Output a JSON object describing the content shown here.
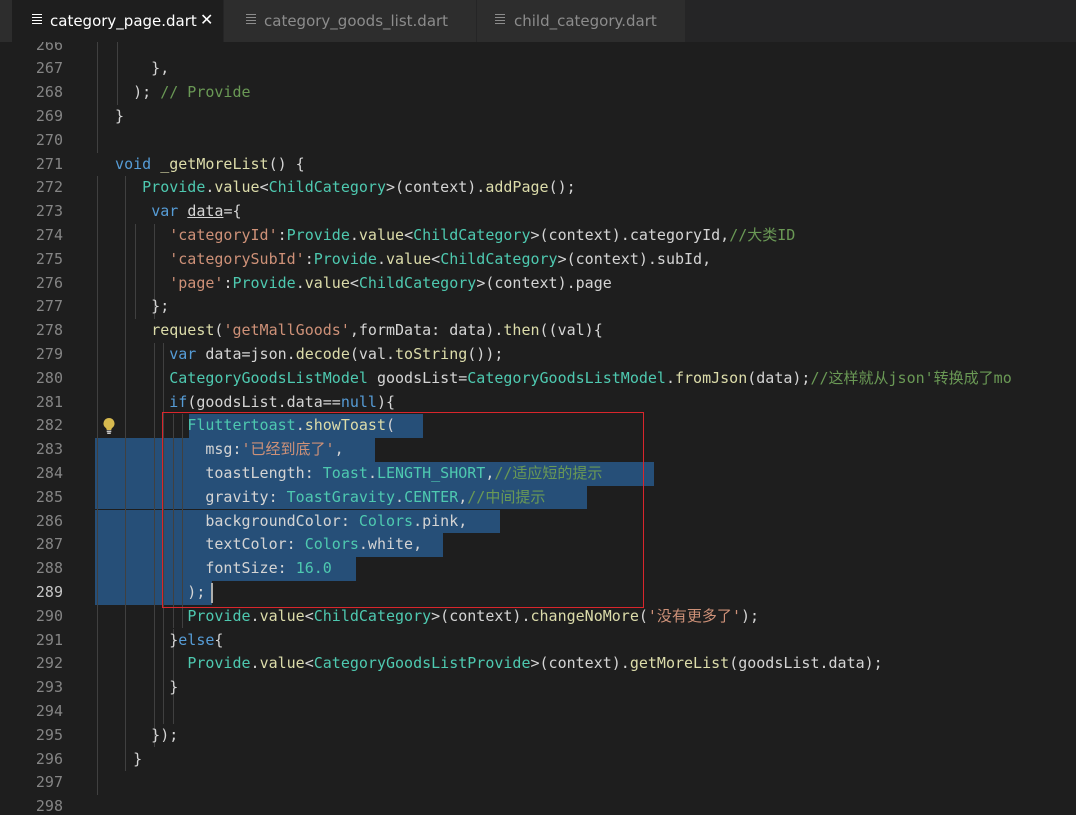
{
  "tabs": [
    {
      "label": "category_page.dart",
      "active": true,
      "close": "✕"
    },
    {
      "label": "category_goods_list.dart",
      "active": false
    },
    {
      "label": "child_category.dart",
      "active": false
    }
  ],
  "colors": {
    "keyword": "#569cd6",
    "type": "#4ec9b0",
    "function": "#dcdcaa",
    "string": "#ce9178",
    "comment": "#6a9955",
    "selection": "#264f78",
    "box": "#d9262c"
  },
  "current_line": 289,
  "lines": [
    {
      "n": 266,
      "t": [
        [
          "id",
          ""
        ]
      ]
    },
    {
      "n": 267,
      "t": [
        [
          "pr",
          "      },"
        ]
      ]
    },
    {
      "n": 268,
      "t": [
        [
          "pr",
          "    ); "
        ],
        [
          "cm",
          "// Provide"
        ]
      ]
    },
    {
      "n": 269,
      "t": [
        [
          "pr",
          "  }"
        ]
      ]
    },
    {
      "n": 270,
      "t": [
        [
          "pr",
          ""
        ]
      ]
    },
    {
      "n": 271,
      "t": [
        [
          "kw",
          "  void"
        ],
        [
          "pr",
          " "
        ],
        [
          "fn",
          "_getMoreList"
        ],
        [
          "pr",
          "() {"
        ]
      ]
    },
    {
      "n": 272,
      "t": [
        [
          "pr",
          "     "
        ],
        [
          "ty",
          "Provide"
        ],
        [
          "pr",
          "."
        ],
        [
          "fn",
          "value"
        ],
        [
          "pr",
          "<"
        ],
        [
          "ty",
          "ChildCategory"
        ],
        [
          "pr",
          ">(context)."
        ],
        [
          "fn",
          "addPage"
        ],
        [
          "pr",
          "();"
        ]
      ]
    },
    {
      "n": 273,
      "t": [
        [
          "pr",
          "      "
        ],
        [
          "kw",
          "var"
        ],
        [
          "pr",
          " "
        ],
        [
          "ul",
          "data"
        ],
        [
          "pr",
          "={"
        ]
      ]
    },
    {
      "n": 274,
      "t": [
        [
          "pr",
          "        "
        ],
        [
          "st",
          "'categoryId'"
        ],
        [
          "pr",
          ":"
        ],
        [
          "ty",
          "Provide"
        ],
        [
          "pr",
          "."
        ],
        [
          "fn",
          "value"
        ],
        [
          "pr",
          "<"
        ],
        [
          "ty",
          "ChildCategory"
        ],
        [
          "pr",
          ">(context).categoryId,"
        ],
        [
          "cm",
          "//大类ID"
        ]
      ]
    },
    {
      "n": 275,
      "t": [
        [
          "pr",
          "        "
        ],
        [
          "st",
          "'categorySubId'"
        ],
        [
          "pr",
          ":"
        ],
        [
          "ty",
          "Provide"
        ],
        [
          "pr",
          "."
        ],
        [
          "fn",
          "value"
        ],
        [
          "pr",
          "<"
        ],
        [
          "ty",
          "ChildCategory"
        ],
        [
          "pr",
          ">(context).subId,"
        ]
      ]
    },
    {
      "n": 276,
      "t": [
        [
          "pr",
          "        "
        ],
        [
          "st",
          "'page'"
        ],
        [
          "pr",
          ":"
        ],
        [
          "ty",
          "Provide"
        ],
        [
          "pr",
          "."
        ],
        [
          "fn",
          "value"
        ],
        [
          "pr",
          "<"
        ],
        [
          "ty",
          "ChildCategory"
        ],
        [
          "pr",
          ">(context).page"
        ]
      ]
    },
    {
      "n": 277,
      "t": [
        [
          "pr",
          "      };"
        ]
      ]
    },
    {
      "n": 278,
      "t": [
        [
          "pr",
          "      "
        ],
        [
          "fn",
          "request"
        ],
        [
          "pr",
          "("
        ],
        [
          "st",
          "'getMallGoods'"
        ],
        [
          "pr",
          ",formData: data)."
        ],
        [
          "fn",
          "then"
        ],
        [
          "pr",
          "((val){"
        ]
      ]
    },
    {
      "n": 279,
      "t": [
        [
          "pr",
          "        "
        ],
        [
          "kw",
          "var"
        ],
        [
          "pr",
          " data=json."
        ],
        [
          "fn",
          "decode"
        ],
        [
          "pr",
          "(val."
        ],
        [
          "fn",
          "toString"
        ],
        [
          "pr",
          "());"
        ]
      ]
    },
    {
      "n": 280,
      "t": [
        [
          "pr",
          "        "
        ],
        [
          "ty",
          "CategoryGoodsListModel"
        ],
        [
          "pr",
          " goodsList="
        ],
        [
          "ty",
          "CategoryGoodsListModel"
        ],
        [
          "pr",
          "."
        ],
        [
          "fn",
          "fromJson"
        ],
        [
          "pr",
          "(data);"
        ],
        [
          "cm",
          "//这样就从json'转换成了mo"
        ]
      ]
    },
    {
      "n": 281,
      "t": [
        [
          "pr",
          "        "
        ],
        [
          "kw",
          "if"
        ],
        [
          "pr",
          "(goodsList.data=="
        ],
        [
          "kw",
          "null"
        ],
        [
          "pr",
          "){"
        ]
      ]
    },
    {
      "n": 282,
      "t": [
        [
          "pr",
          "          "
        ],
        [
          "ty",
          "Fluttertoast"
        ],
        [
          "pr",
          "."
        ],
        [
          "fn",
          "showToast"
        ],
        [
          "pr",
          "("
        ]
      ]
    },
    {
      "n": 283,
      "t": [
        [
          "pr",
          "            msg:"
        ],
        [
          "st",
          "'已经到底了'"
        ],
        [
          "pr",
          ","
        ]
      ]
    },
    {
      "n": 284,
      "t": [
        [
          "pr",
          "            toastLength: "
        ],
        [
          "ty",
          "Toast"
        ],
        [
          "pr",
          "."
        ],
        [
          "ty",
          "LENGTH_SHORT"
        ],
        [
          "pr",
          ","
        ],
        [
          "cm",
          "//适应短的提示"
        ]
      ]
    },
    {
      "n": 285,
      "t": [
        [
          "pr",
          "            gravity: "
        ],
        [
          "ty",
          "ToastGravity"
        ],
        [
          "pr",
          "."
        ],
        [
          "ty",
          "CENTER"
        ],
        [
          "pr",
          ","
        ],
        [
          "cm",
          "//中间提示"
        ]
      ]
    },
    {
      "n": 286,
      "t": [
        [
          "pr",
          "            backgroundColor: "
        ],
        [
          "ty",
          "Colors"
        ],
        [
          "pr",
          ".pink,"
        ]
      ]
    },
    {
      "n": 287,
      "t": [
        [
          "pr",
          "            textColor: "
        ],
        [
          "ty",
          "Colors"
        ],
        [
          "pr",
          ".white,"
        ]
      ]
    },
    {
      "n": 288,
      "t": [
        [
          "pr",
          "            fontSize: "
        ],
        [
          "ty",
          "16.0"
        ]
      ]
    },
    {
      "n": 289,
      "t": [
        [
          "pr",
          "          );"
        ]
      ]
    },
    {
      "n": 290,
      "t": [
        [
          "pr",
          "          "
        ],
        [
          "ty",
          "Provide"
        ],
        [
          "pr",
          "."
        ],
        [
          "fn",
          "value"
        ],
        [
          "pr",
          "<"
        ],
        [
          "ty",
          "ChildCategory"
        ],
        [
          "pr",
          ">(context)."
        ],
        [
          "fn",
          "changeNoMore"
        ],
        [
          "pr",
          "("
        ],
        [
          "st",
          "'没有更多了'"
        ],
        [
          "pr",
          ");"
        ]
      ]
    },
    {
      "n": 291,
      "t": [
        [
          "pr",
          "        }"
        ],
        [
          "kw",
          "else"
        ],
        [
          "pr",
          "{"
        ]
      ]
    },
    {
      "n": 292,
      "t": [
        [
          "pr",
          "          "
        ],
        [
          "ty",
          "Provide"
        ],
        [
          "pr",
          "."
        ],
        [
          "fn",
          "value"
        ],
        [
          "pr",
          "<"
        ],
        [
          "ty",
          "CategoryGoodsListProvide"
        ],
        [
          "pr",
          ">(context)."
        ],
        [
          "fn",
          "getMoreList"
        ],
        [
          "pr",
          "(goodsList.data);"
        ]
      ]
    },
    {
      "n": 293,
      "t": [
        [
          "pr",
          "        }"
        ]
      ]
    },
    {
      "n": 294,
      "t": [
        [
          "pr",
          ""
        ]
      ]
    },
    {
      "n": 295,
      "t": [
        [
          "pr",
          "      });"
        ]
      ]
    },
    {
      "n": 296,
      "t": [
        [
          "pr",
          "    }"
        ]
      ]
    },
    {
      "n": 297,
      "t": [
        [
          "pr",
          ""
        ]
      ]
    },
    {
      "n": 298,
      "t": [
        [
          "pr",
          ""
        ]
      ]
    }
  ]
}
